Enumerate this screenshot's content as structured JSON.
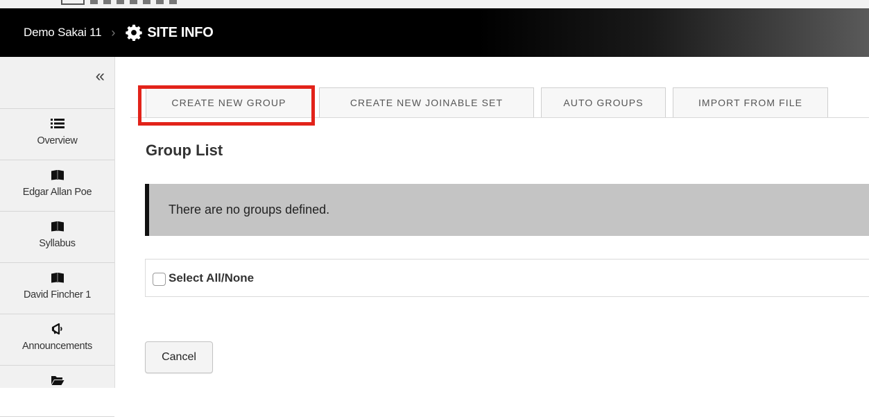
{
  "header": {
    "site_name": "Demo Sakai 11",
    "breadcrumb_separator": "›",
    "tool_title": "SITE INFO",
    "tool_icon": "gear-icon"
  },
  "sidebar": {
    "collapse_glyph": "«",
    "items": [
      {
        "label": "Overview",
        "icon": "list-icon"
      },
      {
        "label": "Edgar Allan Poe",
        "icon": "book-icon"
      },
      {
        "label": "Syllabus",
        "icon": "book-icon"
      },
      {
        "label": "David Fincher 1",
        "icon": "book-icon"
      },
      {
        "label": "Announcements",
        "icon": "megaphone-icon"
      },
      {
        "label": "",
        "icon": "folder-icon"
      }
    ]
  },
  "tabs": [
    {
      "label": "CREATE NEW GROUP",
      "highlighted": true
    },
    {
      "label": "CREATE NEW JOINABLE SET"
    },
    {
      "label": "AUTO GROUPS"
    },
    {
      "label": "IMPORT FROM FILE"
    }
  ],
  "main": {
    "title": "Group List",
    "empty_message": "There are no groups defined.",
    "select_all_label": "Select All/None",
    "select_all_checked": false,
    "cancel_label": "Cancel"
  },
  "colors": {
    "header_bg": "#000000",
    "highlight": "#e2231a",
    "message_bg": "#c4c4c4"
  }
}
